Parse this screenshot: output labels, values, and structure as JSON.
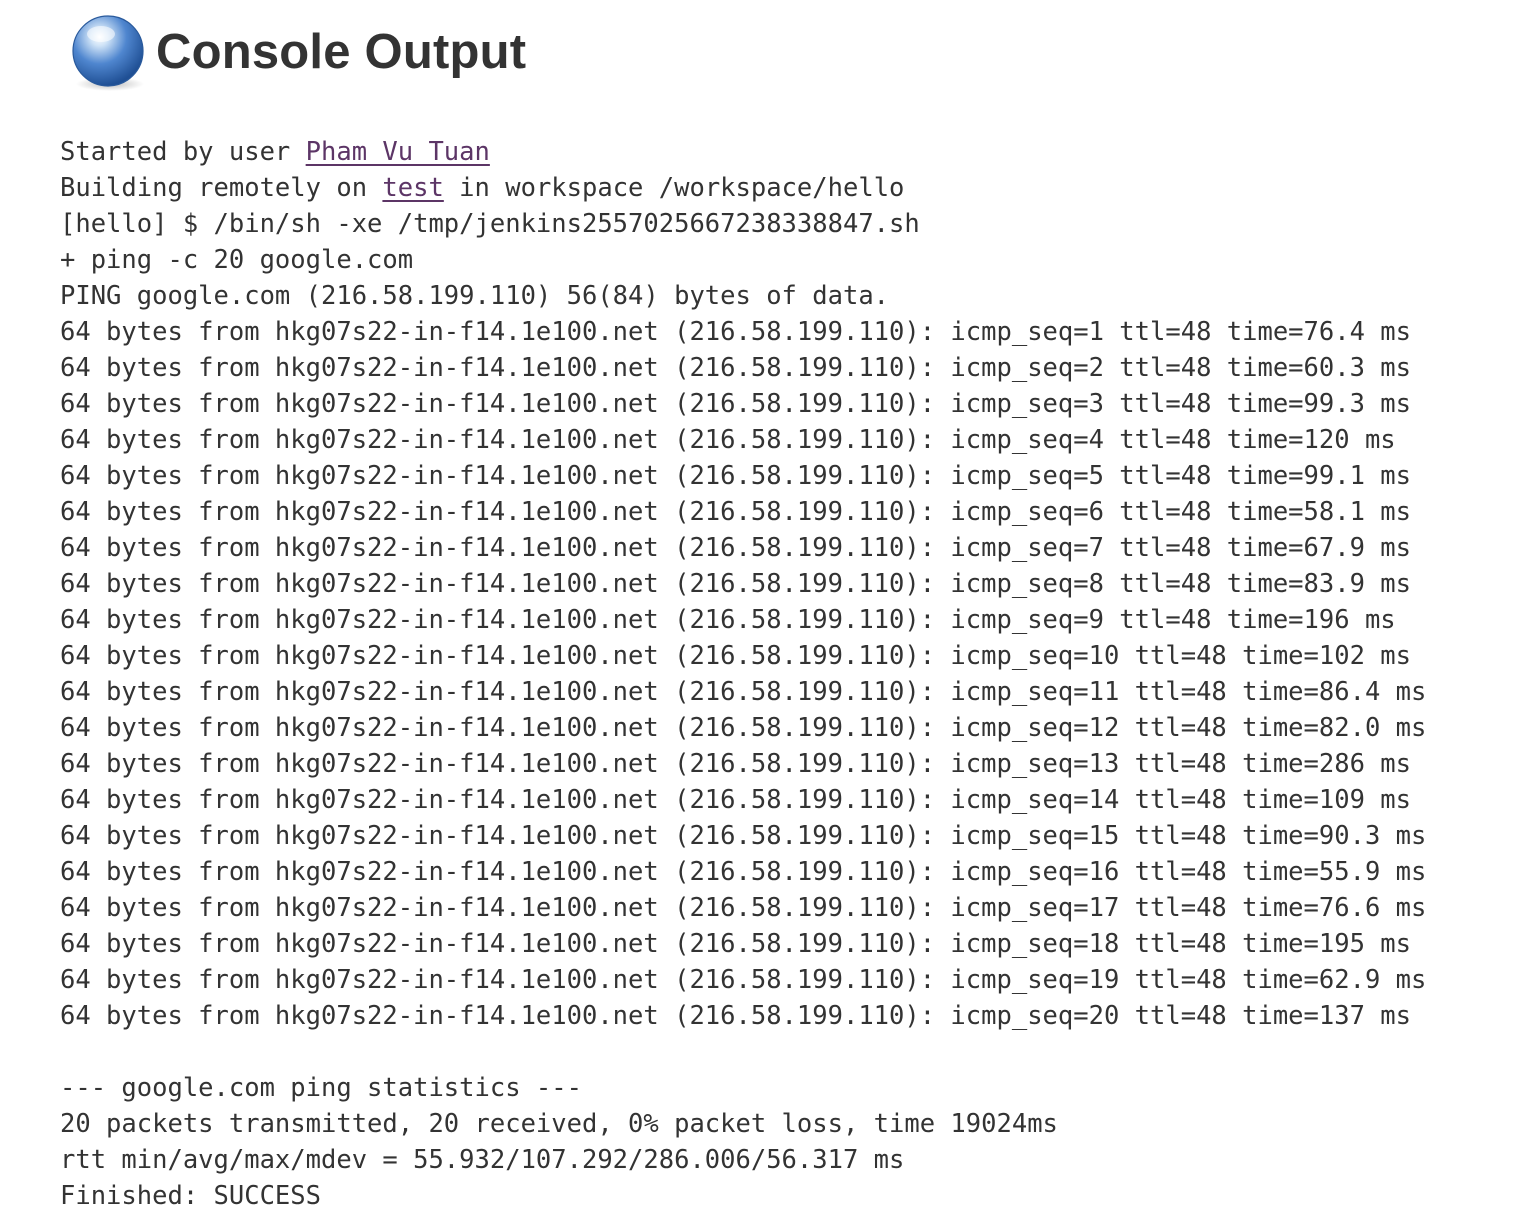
{
  "page": {
    "title": "Console Output",
    "icon": "blue-orb-icon"
  },
  "console": {
    "started_prefix": "Started by user ",
    "user_link": "Pham Vu Tuan",
    "building_prefix": "Building remotely on ",
    "node_link": "test",
    "building_suffix": " in workspace /workspace/hello",
    "lines_before_ping": [
      "[hello] $ /bin/sh -xe /tmp/jenkins2557025667238338847.sh",
      "+ ping -c 20 google.com",
      "PING google.com (216.58.199.110) 56(84) bytes of data."
    ],
    "ping_replies": [
      "64 bytes from hkg07s22-in-f14.1e100.net (216.58.199.110): icmp_seq=1 ttl=48 time=76.4 ms",
      "64 bytes from hkg07s22-in-f14.1e100.net (216.58.199.110): icmp_seq=2 ttl=48 time=60.3 ms",
      "64 bytes from hkg07s22-in-f14.1e100.net (216.58.199.110): icmp_seq=3 ttl=48 time=99.3 ms",
      "64 bytes from hkg07s22-in-f14.1e100.net (216.58.199.110): icmp_seq=4 ttl=48 time=120 ms",
      "64 bytes from hkg07s22-in-f14.1e100.net (216.58.199.110): icmp_seq=5 ttl=48 time=99.1 ms",
      "64 bytes from hkg07s22-in-f14.1e100.net (216.58.199.110): icmp_seq=6 ttl=48 time=58.1 ms",
      "64 bytes from hkg07s22-in-f14.1e100.net (216.58.199.110): icmp_seq=7 ttl=48 time=67.9 ms",
      "64 bytes from hkg07s22-in-f14.1e100.net (216.58.199.110): icmp_seq=8 ttl=48 time=83.9 ms",
      "64 bytes from hkg07s22-in-f14.1e100.net (216.58.199.110): icmp_seq=9 ttl=48 time=196 ms",
      "64 bytes from hkg07s22-in-f14.1e100.net (216.58.199.110): icmp_seq=10 ttl=48 time=102 ms",
      "64 bytes from hkg07s22-in-f14.1e100.net (216.58.199.110): icmp_seq=11 ttl=48 time=86.4 ms",
      "64 bytes from hkg07s22-in-f14.1e100.net (216.58.199.110): icmp_seq=12 ttl=48 time=82.0 ms",
      "64 bytes from hkg07s22-in-f14.1e100.net (216.58.199.110): icmp_seq=13 ttl=48 time=286 ms",
      "64 bytes from hkg07s22-in-f14.1e100.net (216.58.199.110): icmp_seq=14 ttl=48 time=109 ms",
      "64 bytes from hkg07s22-in-f14.1e100.net (216.58.199.110): icmp_seq=15 ttl=48 time=90.3 ms",
      "64 bytes from hkg07s22-in-f14.1e100.net (216.58.199.110): icmp_seq=16 ttl=48 time=55.9 ms",
      "64 bytes from hkg07s22-in-f14.1e100.net (216.58.199.110): icmp_seq=17 ttl=48 time=76.6 ms",
      "64 bytes from hkg07s22-in-f14.1e100.net (216.58.199.110): icmp_seq=18 ttl=48 time=195 ms",
      "64 bytes from hkg07s22-in-f14.1e100.net (216.58.199.110): icmp_seq=19 ttl=48 time=62.9 ms",
      "64 bytes from hkg07s22-in-f14.1e100.net (216.58.199.110): icmp_seq=20 ttl=48 time=137 ms"
    ],
    "statistics": [
      "--- google.com ping statistics ---",
      "20 packets transmitted, 20 received, 0% packet loss, time 19024ms",
      "rtt min/avg/max/mdev = 55.932/107.292/286.006/56.317 ms",
      "Finished: SUCCESS"
    ]
  },
  "colors": {
    "text": "#333333",
    "link": "#5c3566",
    "orb_light": "#cfe3f7",
    "orb_dark": "#1f4f94"
  }
}
